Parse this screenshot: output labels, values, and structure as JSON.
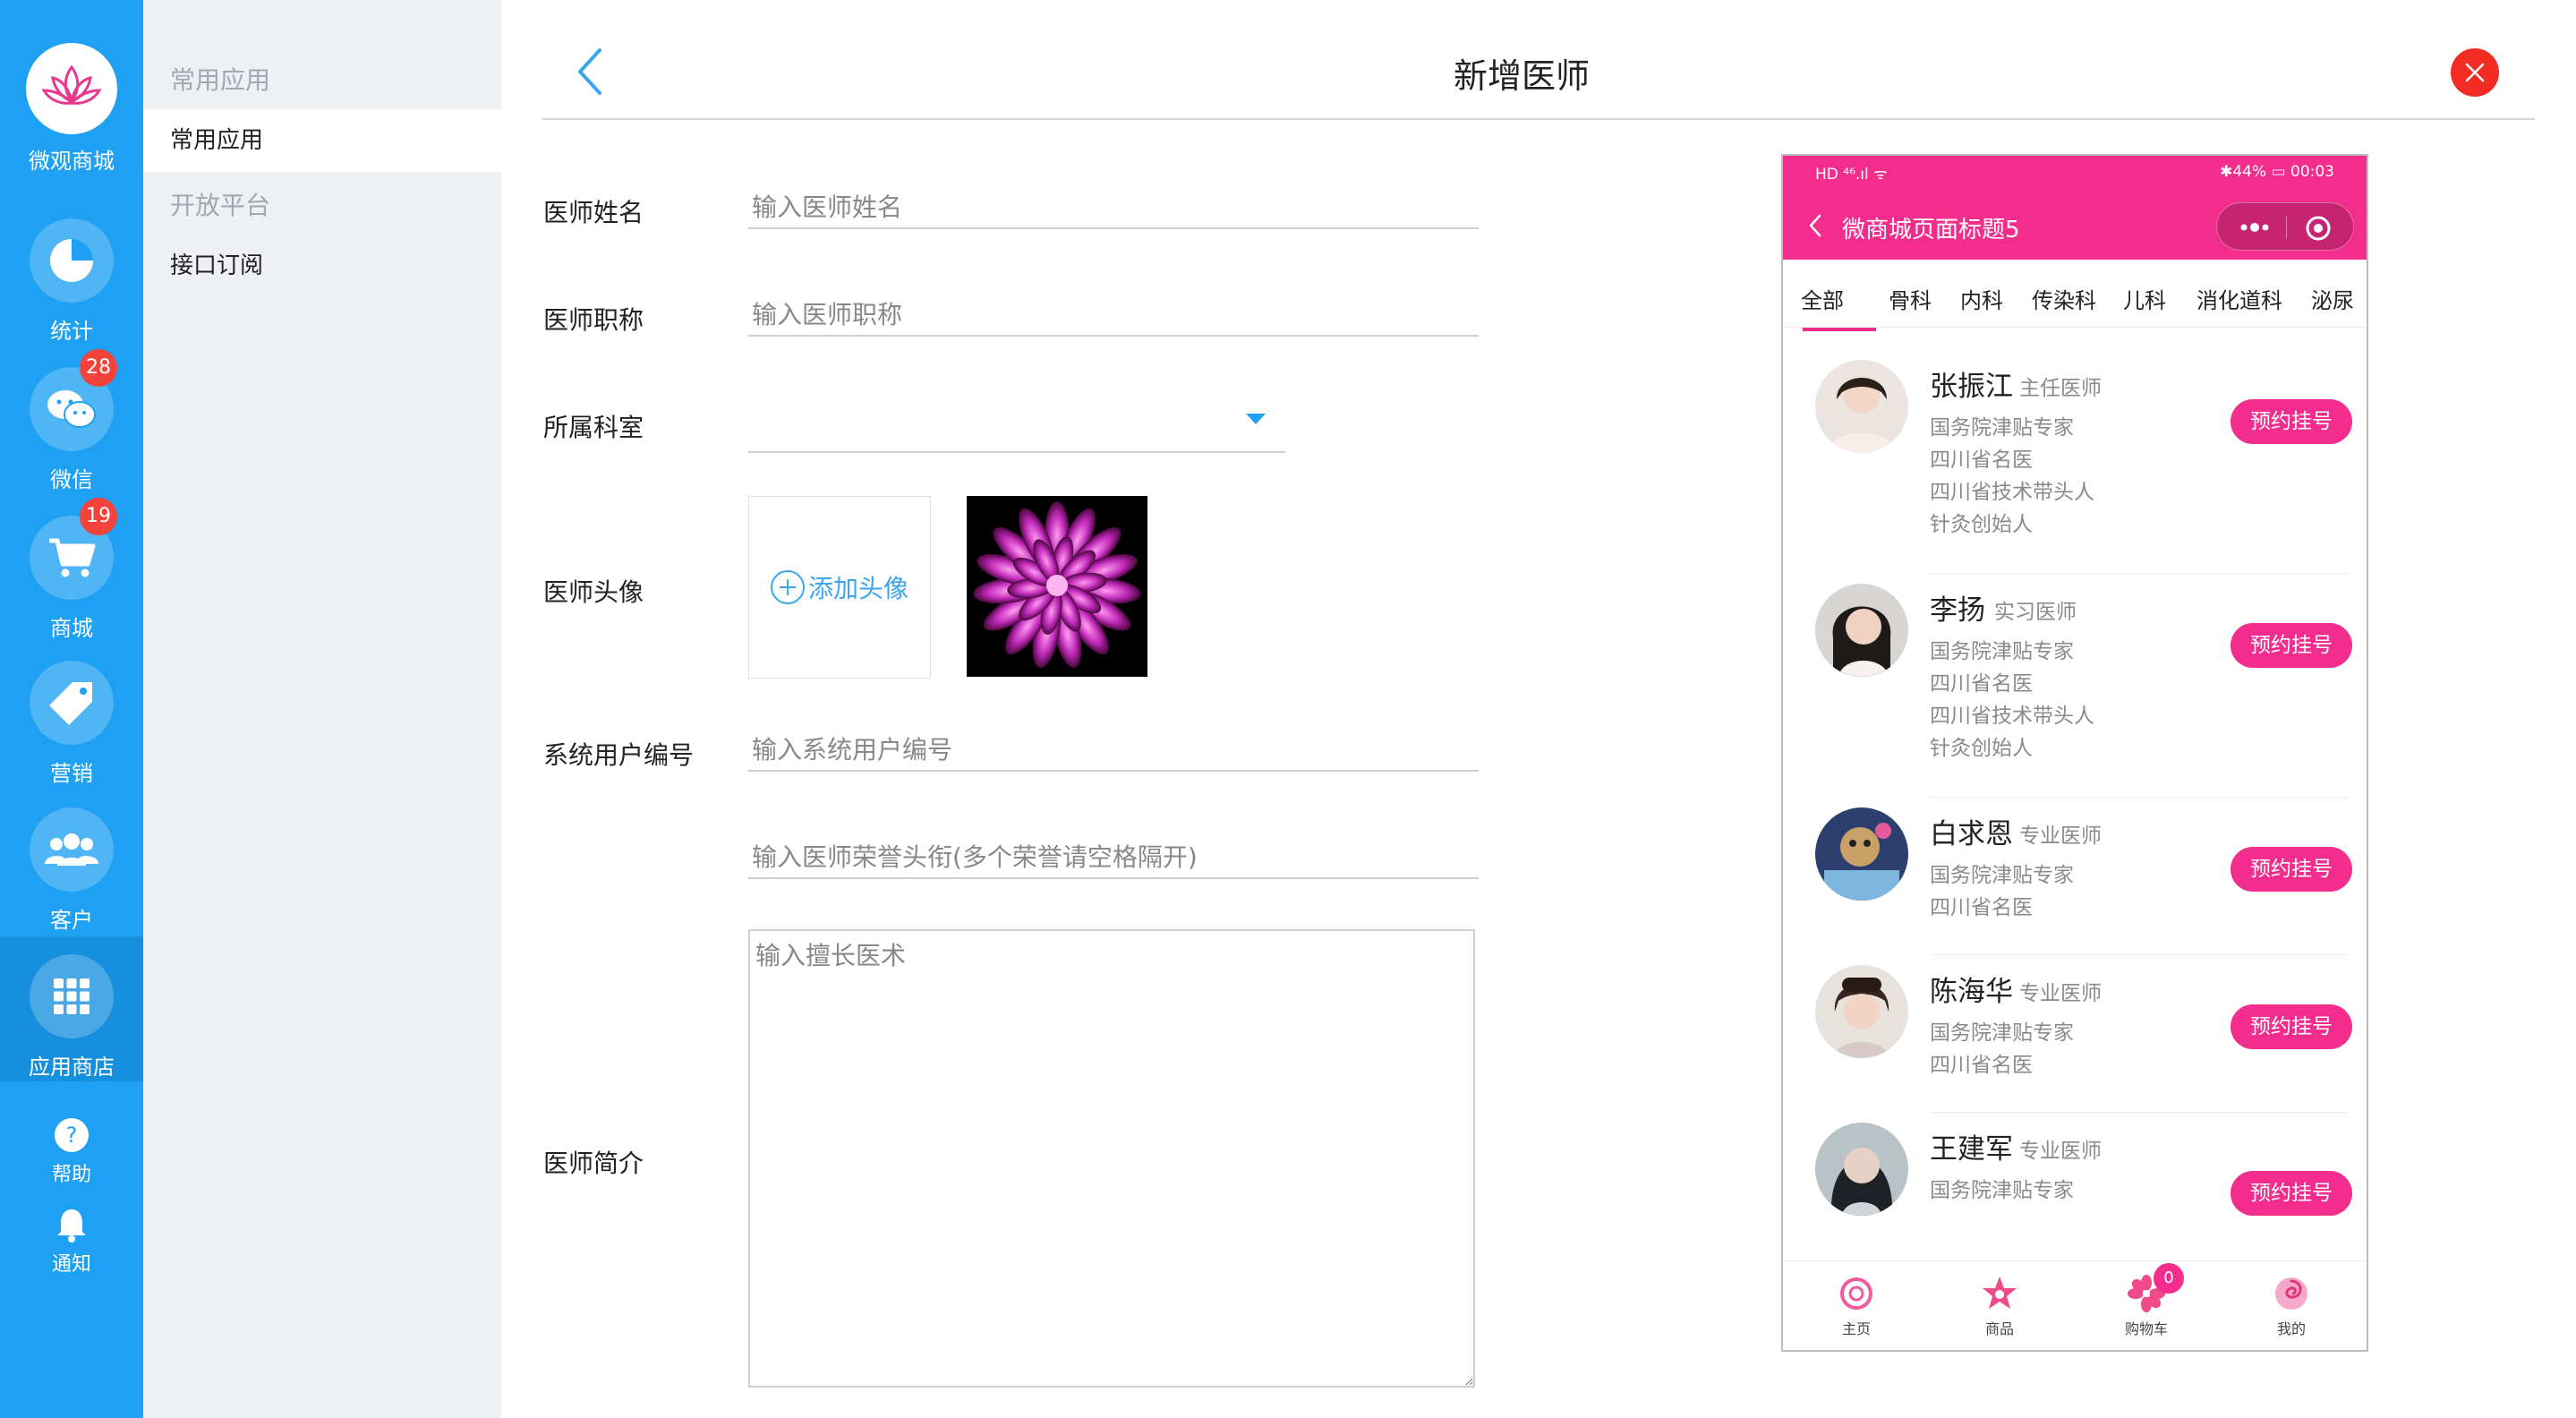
{
  "nav": {
    "brand": "微观商城",
    "items": [
      {
        "label": "统计",
        "icon": "pie-chart-icon"
      },
      {
        "label": "微信",
        "icon": "wechat-icon",
        "badge": "28"
      },
      {
        "label": "商城",
        "icon": "cart-icon",
        "badge": "19"
      },
      {
        "label": "营销",
        "icon": "tag-icon"
      },
      {
        "label": "客户",
        "icon": "users-icon"
      },
      {
        "label": "应用商店",
        "icon": "apps-grid-icon"
      }
    ],
    "help": "帮助",
    "notify": "通知"
  },
  "subnav": {
    "group1": "常用应用",
    "item1": "常用应用",
    "group2": "开放平台",
    "item2": "接口订阅"
  },
  "header": {
    "title": "新增医师"
  },
  "form": {
    "name_label": "医师姓名",
    "name_placeholder": "输入医师姓名",
    "title_label": "医师职称",
    "title_placeholder": "输入医师职称",
    "dept_label": "所属科室",
    "avatar_label": "医师头像",
    "avatar_add": "添加头像",
    "userno_label": "系统用户编号",
    "userno_placeholder": "输入系统用户编号",
    "honor_placeholder": "输入医师荣誉头衔(多个荣誉请空格隔开)",
    "intro_label": "医师简介",
    "intro_placeholder": "输入擅长医术"
  },
  "phone": {
    "status_left": "HD ⁴⁶.ıl ᯤ",
    "status_right": "✱44% ▭ 00:03",
    "title": "微商城页面标题5",
    "tabs": [
      "全部",
      "骨科",
      "内科",
      "传染科",
      "儿科",
      "消化道科",
      "泌尿"
    ],
    "doctors": [
      {
        "name": "张振江",
        "title": "主任医师",
        "lines": [
          "国务院津贴专家",
          "四川省名医",
          "四川省技术带头人",
          "针灸创始人"
        ],
        "button": "预约挂号"
      },
      {
        "name": "李扬",
        "title": "实习医师",
        "lines": [
          "国务院津贴专家",
          "四川省名医",
          "四川省技术带头人",
          "针灸创始人"
        ],
        "button": "预约挂号"
      },
      {
        "name": "白求恩",
        "title": "专业医师",
        "lines": [
          "国务院津贴专家",
          "四川省名医"
        ],
        "button": "预约挂号"
      },
      {
        "name": "陈海华",
        "title": "专业医师",
        "lines": [
          "国务院津贴专家",
          "四川省名医"
        ],
        "button": "预约挂号"
      },
      {
        "name": "王建军",
        "title": "专业医师",
        "lines": [
          "国务院津贴专家"
        ],
        "button": "预约挂号"
      }
    ],
    "tabbar": [
      {
        "label": "主页",
        "icon": "home-ring-icon"
      },
      {
        "label": "商品",
        "icon": "star-icon"
      },
      {
        "label": "购物车",
        "icon": "flower-icon",
        "badge": "0"
      },
      {
        "label": "我的",
        "icon": "swirl-icon"
      }
    ]
  },
  "colors": {
    "nav_blue": "#1ea0f3",
    "accent_pink": "#f22d8d",
    "close_red": "#f22c22"
  }
}
